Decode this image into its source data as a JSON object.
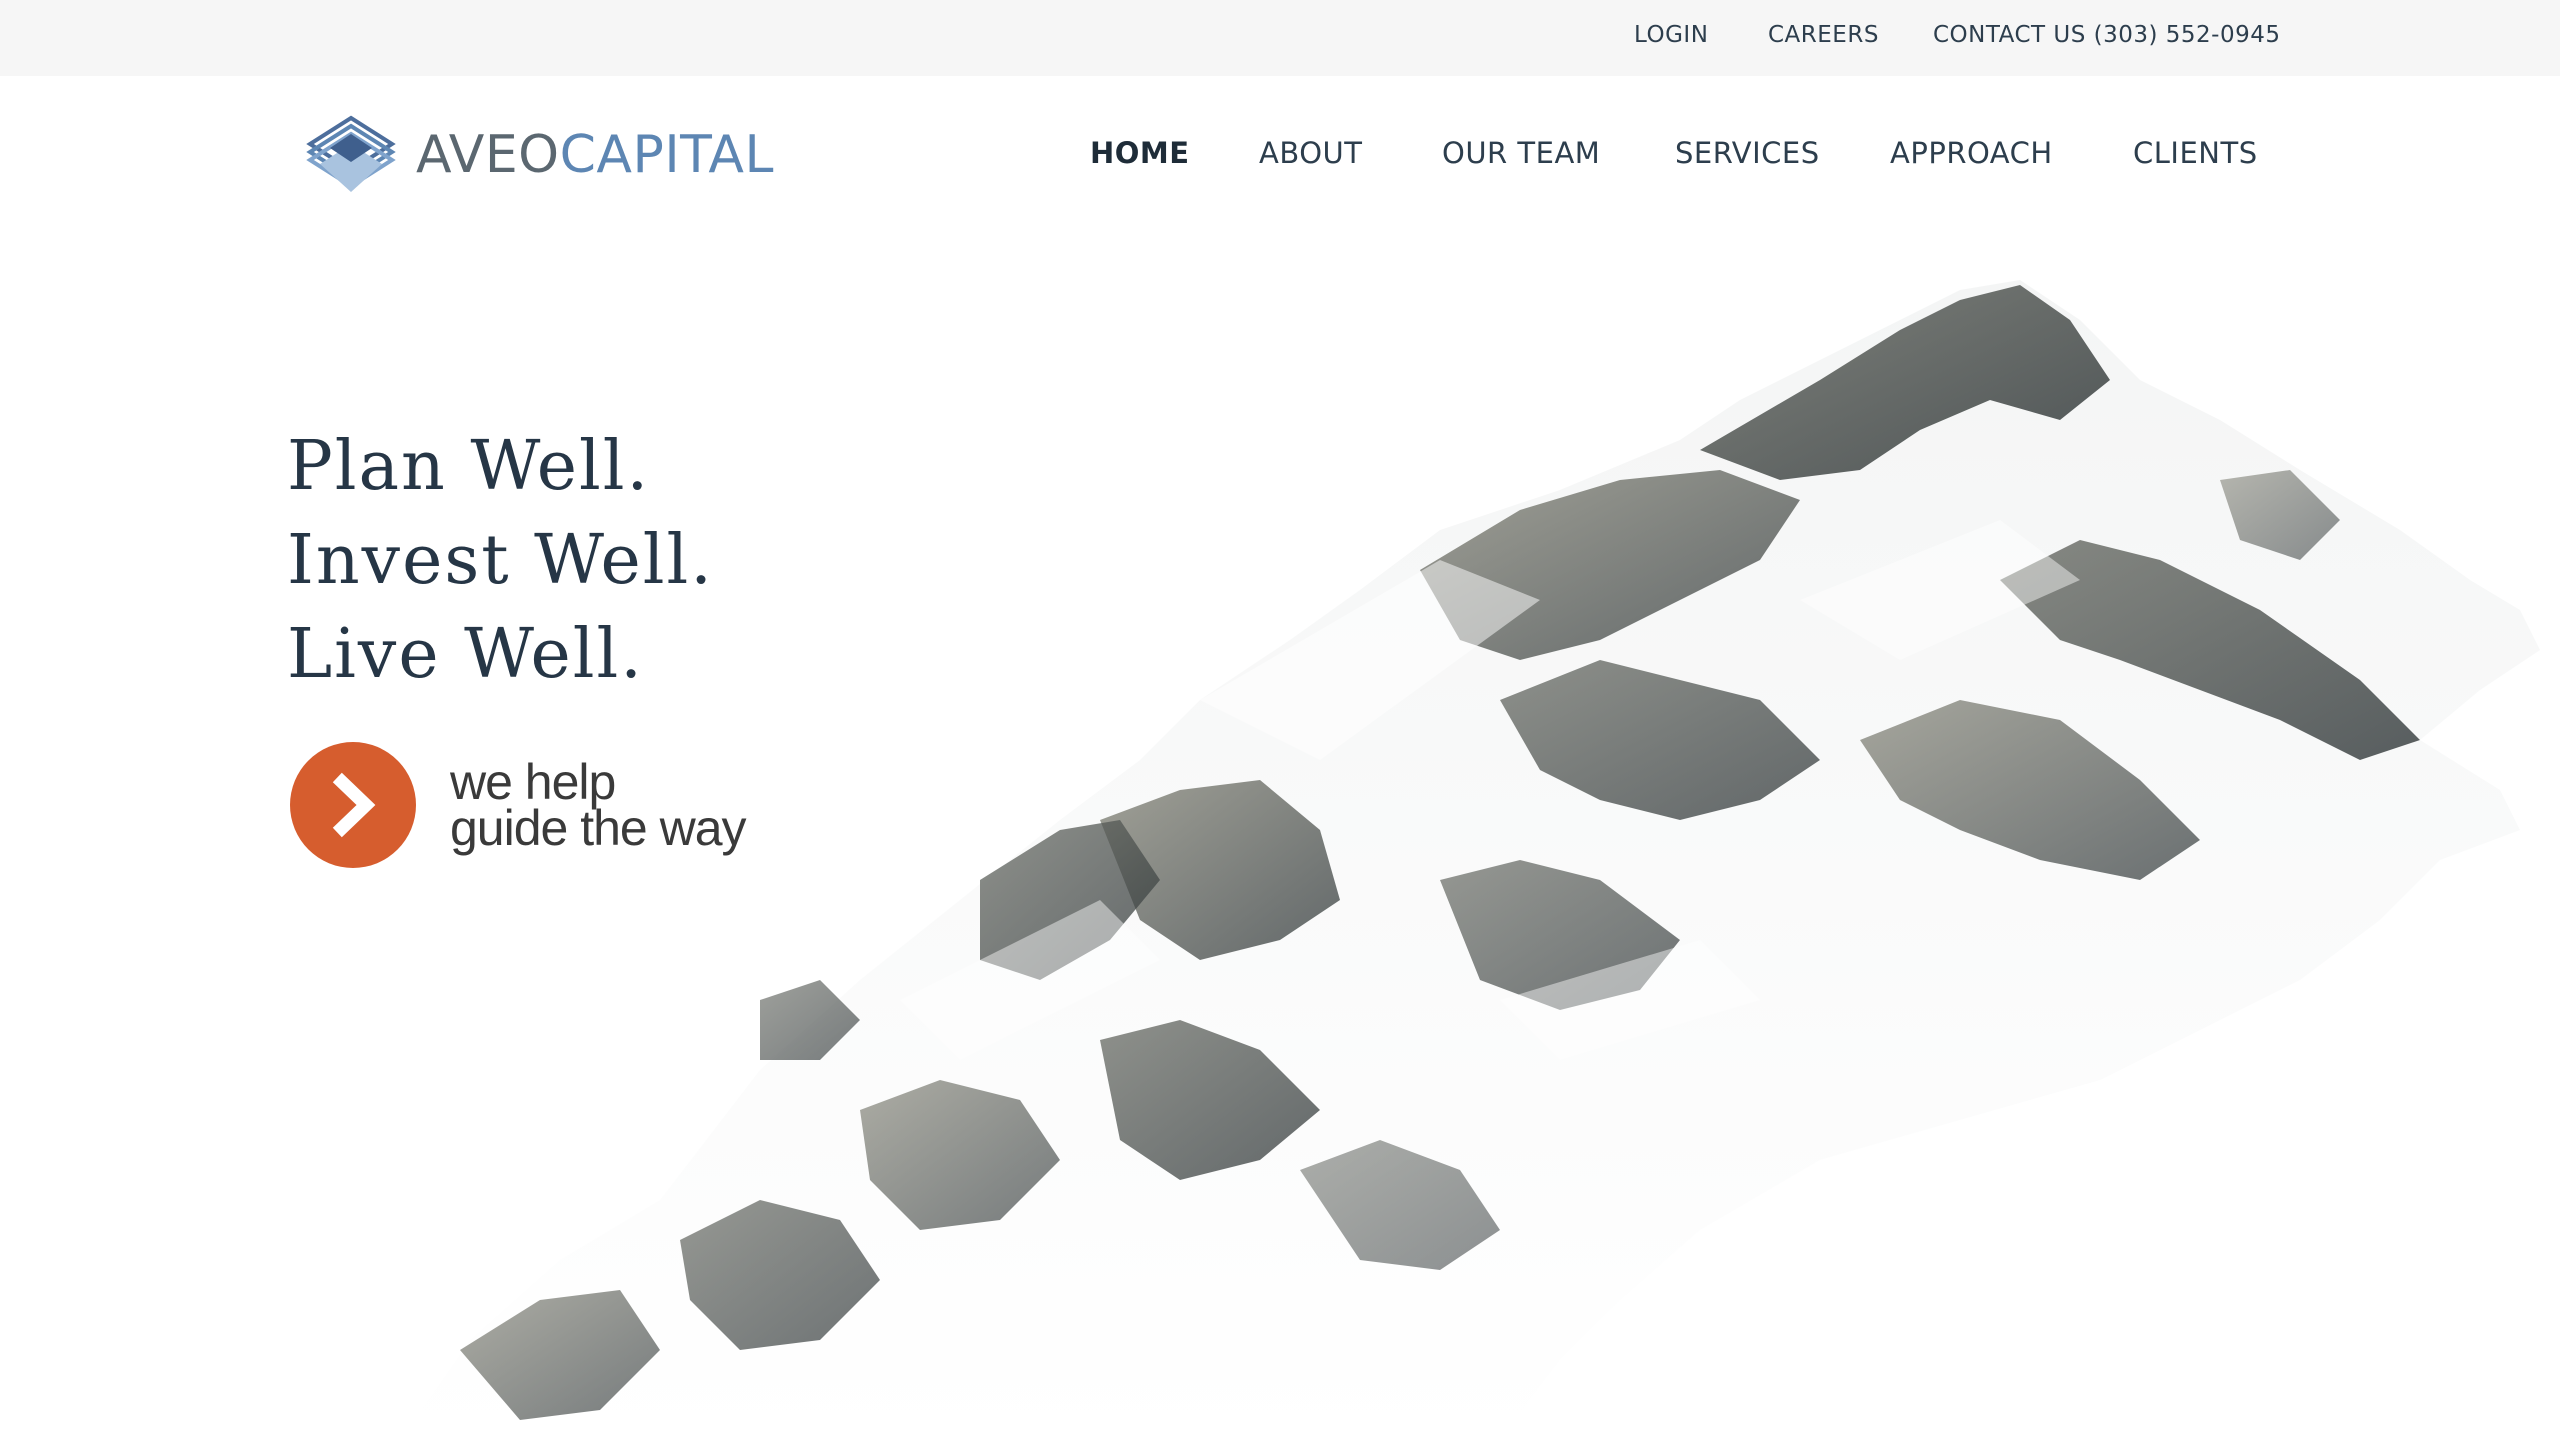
{
  "topbar": {
    "login": "LOGIN",
    "careers": "CAREERS",
    "contact": "CONTACT US (303) 552-0945"
  },
  "logo": {
    "word1": "AVEO",
    "word2": "CAPITAL",
    "icon": "layered-diamond-logo-icon"
  },
  "nav": {
    "home": "HOME",
    "about": "ABOUT",
    "our_team": "OUR TEAM",
    "services": "SERVICES",
    "approach": "APPROACH",
    "clients": "CLIENTS",
    "active": "HOME"
  },
  "hero": {
    "line1": "Plan Well.",
    "line2": "Invest Well.",
    "line3": "Live Well."
  },
  "cta": {
    "line1": "we help",
    "line2": "guide the way",
    "icon": "chevron-right-icon"
  },
  "colors": {
    "topbar_bg": "#f6f6f6",
    "text_dark": "#2d3e4d",
    "logo_gray": "#5b6770",
    "logo_blue": "#5d86b3",
    "cta_orange": "#d65d2e"
  }
}
